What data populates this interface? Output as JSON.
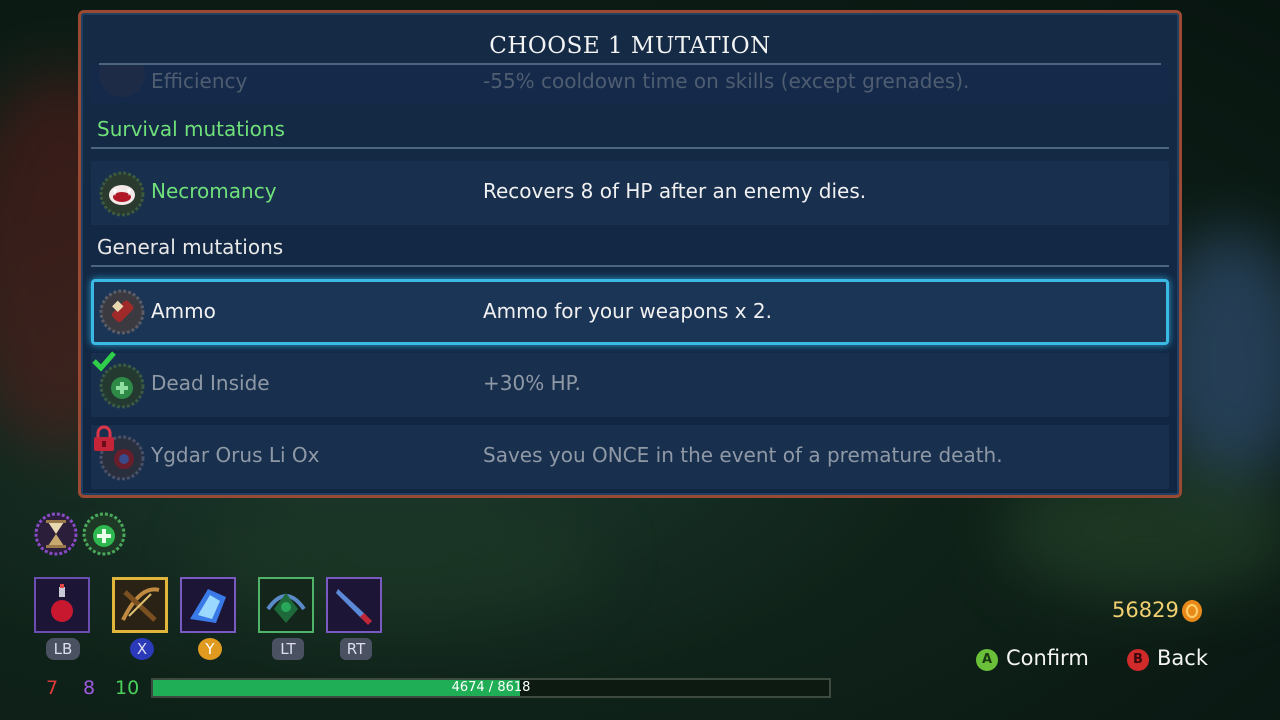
{
  "panel": {
    "title": "CHOOSE 1 MUTATION",
    "partial_row": {
      "name": "Efficiency",
      "desc": "-55% cooldown time on skills (except grenades)."
    },
    "sections": [
      {
        "heading": "Survival mutations",
        "heading_color": "#6fe07a",
        "rows": [
          {
            "name": "Necromancy",
            "desc": "Recovers 8 of HP after an enemy dies.",
            "name_color": "#6fe07a",
            "icon": "fanged-mouth-icon",
            "state": "normal"
          }
        ]
      },
      {
        "heading": "General mutations",
        "heading_color": "#e8e8e8",
        "rows": [
          {
            "name": "Ammo",
            "desc": "Ammo for your weapons x 2.",
            "name_color": "#f2f2f2",
            "icon": "ammo-icon",
            "state": "selected"
          },
          {
            "name": "Dead Inside",
            "desc": "+30% HP.",
            "name_color": "#8f99a6",
            "icon": "green-heart-icon",
            "state": "equipped"
          },
          {
            "name": "Ygdar Orus Li Ox",
            "desc": "Saves you ONCE in the event of a premature death.",
            "name_color": "#8f99a6",
            "icon": "tree-icon",
            "state": "locked"
          }
        ]
      }
    ]
  },
  "active_mutations": [
    "hourglass-icon",
    "green-heart-plus-icon"
  ],
  "hud": {
    "slots": [
      {
        "label": "LB",
        "icon": "health-flask-icon",
        "border": "#6b4fb0"
      },
      {
        "label": "X",
        "icon": "crossbow-icon",
        "border": "#e0b53a"
      },
      {
        "label": "Y",
        "icon": "ice-shard-icon",
        "border": "#7a5ac0"
      },
      {
        "label": "LT",
        "icon": "tree-guardian-icon",
        "border": "#4fb36a"
      },
      {
        "label": "RT",
        "icon": "knife-icon",
        "border": "#7a5ac0"
      }
    ],
    "stats": {
      "brutality": "7",
      "tactics": "8",
      "survival": "10"
    },
    "hp": {
      "current": 4674,
      "max": 8618,
      "text": "4674 / 8618"
    },
    "gold": "56829",
    "confirm_label": "Confirm",
    "back_label": "Back",
    "confirm_btn": "A",
    "back_btn": "B"
  }
}
